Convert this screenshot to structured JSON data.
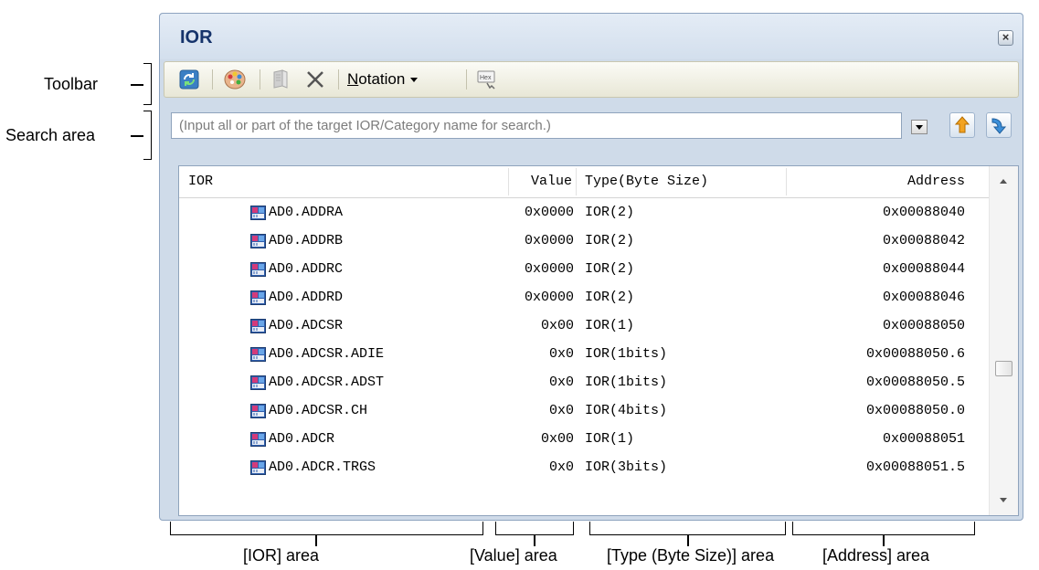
{
  "callouts": {
    "toolbar": "Toolbar",
    "search_area": "Search area",
    "ior_area": "[IOR] area",
    "value_area": "[Value] area",
    "type_area": "[Type (Byte Size)] area",
    "address_area": "[Address] area"
  },
  "panel": {
    "title": "IOR",
    "close_icon": "close-icon"
  },
  "toolbar": {
    "refresh_icon": "refresh-icon",
    "color_icon": "palette-icon",
    "book_icon": "book-icon",
    "delete_icon": "delete-icon",
    "notation_label": "Notation",
    "notation_mnemonic": "N",
    "hex_icon": "hex-icon",
    "hex_label": "Hex"
  },
  "search": {
    "placeholder": "(Input all or part of the target IOR/Category name for search.)",
    "up_icon": "arrow-up-icon",
    "down_icon": "arrow-down-icon"
  },
  "grid": {
    "columns": [
      "IOR",
      "Value",
      "Type(Byte Size)",
      "Address"
    ],
    "rows": [
      {
        "name": "AD0.ADDRA",
        "value": "0x0000",
        "type": "IOR(2)",
        "address": "0x00088040"
      },
      {
        "name": "AD0.ADDRB",
        "value": "0x0000",
        "type": "IOR(2)",
        "address": "0x00088042"
      },
      {
        "name": "AD0.ADDRC",
        "value": "0x0000",
        "type": "IOR(2)",
        "address": "0x00088044"
      },
      {
        "name": "AD0.ADDRD",
        "value": "0x0000",
        "type": "IOR(2)",
        "address": "0x00088046"
      },
      {
        "name": "AD0.ADCSR",
        "value": "0x00",
        "type": "IOR(1)",
        "address": "0x00088050"
      },
      {
        "name": "AD0.ADCSR.ADIE",
        "value": "0x0",
        "type": "IOR(1bits)",
        "address": "0x00088050.6"
      },
      {
        "name": "AD0.ADCSR.ADST",
        "value": "0x0",
        "type": "IOR(1bits)",
        "address": "0x00088050.5"
      },
      {
        "name": "AD0.ADCSR.CH",
        "value": "0x0",
        "type": "IOR(4bits)",
        "address": "0x00088050.0"
      },
      {
        "name": "AD0.ADCR",
        "value": "0x00",
        "type": "IOR(1)",
        "address": "0x00088051"
      },
      {
        "name": "AD0.ADCR.TRGS",
        "value": "0x0",
        "type": "IOR(3bits)",
        "address": "0x00088051.5"
      }
    ],
    "scroll_position": 0.6
  }
}
